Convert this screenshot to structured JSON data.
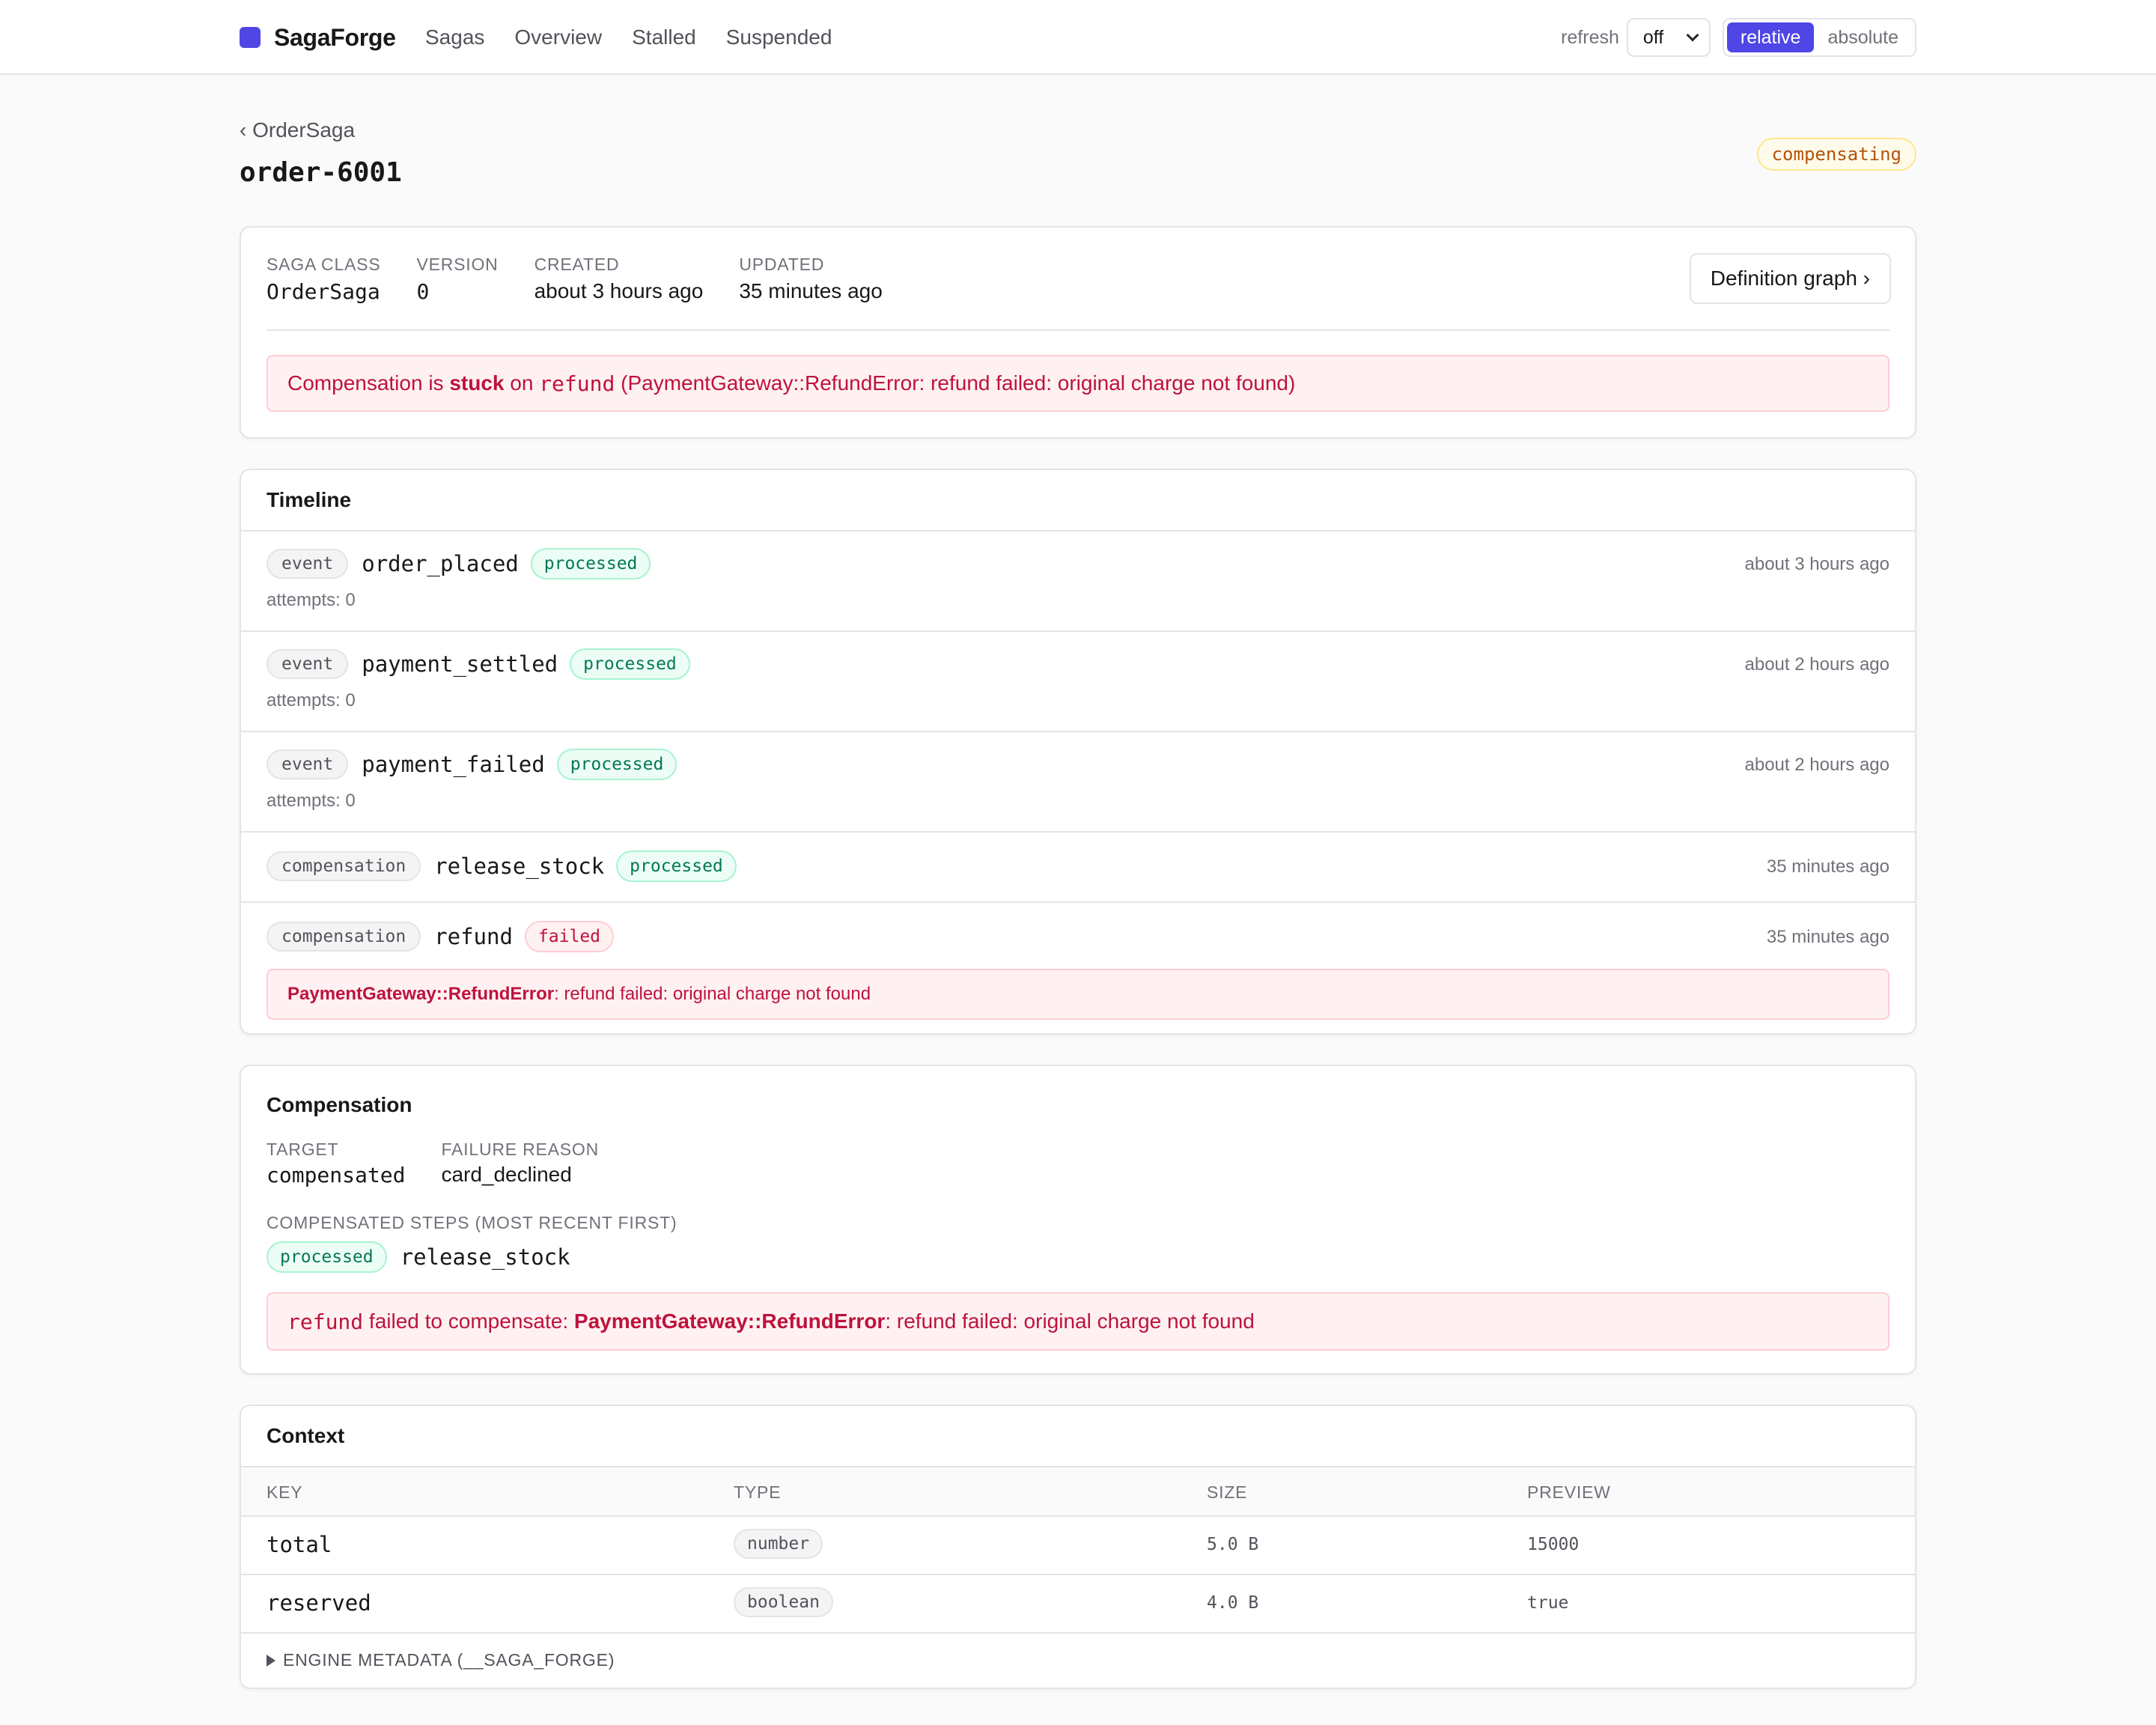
{
  "app": {
    "brand": "SagaForge",
    "nav": [
      "Sagas",
      "Overview",
      "Stalled",
      "Suspended"
    ],
    "refresh_label": "refresh",
    "refresh_value": "off",
    "time_modes": [
      "relative",
      "absolute"
    ],
    "active_time_mode": "relative",
    "colors": {
      "accent": "#4f46e5",
      "success": "#047857",
      "error": "#be123c",
      "warning": "#b45309"
    }
  },
  "header": {
    "back_label": "‹ OrderSaga",
    "title": "order-6001",
    "status": "compensating"
  },
  "summary": {
    "saga_class_label": "SAGA CLASS",
    "saga_class": "OrderSaga",
    "version_label": "VERSION",
    "version": "0",
    "created_label": "CREATED",
    "created": "about 3 hours ago",
    "updated_label": "UPDATED",
    "updated": "35 minutes ago",
    "definition_button": "Definition graph ›",
    "alert_prefix": "Compensation is ",
    "alert_strong": "stuck",
    "alert_on": " on ",
    "alert_step": "refund",
    "alert_suffix": " (PaymentGateway::RefundError: refund failed: original charge not found)"
  },
  "timeline": {
    "title": "Timeline",
    "rows": [
      {
        "kind": "event",
        "name": "order_placed",
        "status": "processed",
        "attempts": "attempts: 0",
        "time": "about 3 hours ago"
      },
      {
        "kind": "event",
        "name": "payment_settled",
        "status": "processed",
        "attempts": "attempts: 0",
        "time": "about 2 hours ago"
      },
      {
        "kind": "event",
        "name": "payment_failed",
        "status": "processed",
        "attempts": "attempts: 0",
        "time": "about 2 hours ago"
      },
      {
        "kind": "compensation",
        "name": "release_stock",
        "status": "processed",
        "time": "35 minutes ago"
      },
      {
        "kind": "compensation",
        "name": "refund",
        "status": "failed",
        "time": "35 minutes ago",
        "error_class": "PaymentGateway::RefundError",
        "error_message": ": refund failed: original charge not found"
      }
    ]
  },
  "compensation": {
    "title": "Compensation",
    "target_label": "TARGET",
    "target": "compensated",
    "failure_reason_label": "FAILURE REASON",
    "failure_reason": "card_declined",
    "steps_label": "COMPENSATED STEPS (MOST RECENT FIRST)",
    "steps": [
      {
        "status": "processed",
        "name": "release_stock"
      }
    ],
    "alert_step": "refund",
    "alert_text": " failed to compensate: ",
    "alert_error_class": "PaymentGateway::RefundError",
    "alert_error_message": ": refund failed: original charge not found"
  },
  "context": {
    "title": "Context",
    "columns": [
      "KEY",
      "TYPE",
      "SIZE",
      "PREVIEW"
    ],
    "rows": [
      {
        "key": "total",
        "type": "number",
        "size": "5.0 B",
        "preview": "15000"
      },
      {
        "key": "reserved",
        "type": "boolean",
        "size": "4.0 B",
        "preview": "true"
      }
    ],
    "metadata_toggle": "ENGINE METADATA (__SAGA_FORGE)"
  }
}
